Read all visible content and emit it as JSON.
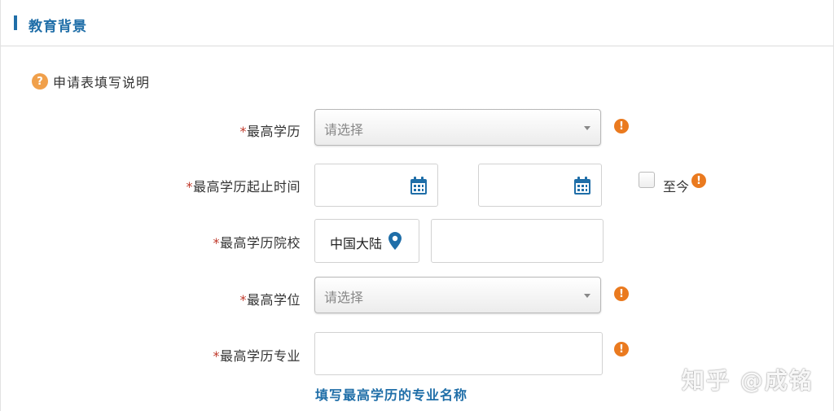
{
  "section": {
    "title": "教育背景"
  },
  "help": {
    "text": "申请表填写说明",
    "icon": "question-icon",
    "icon_glyph": "?"
  },
  "form": {
    "required_mark": "*",
    "highest_education": {
      "label": "最高学历",
      "placeholder": "请选择"
    },
    "education_period": {
      "label": "最高学历起止时间",
      "until_now_label": "至今"
    },
    "school": {
      "label": "最高学历院校",
      "region": "中国大陆"
    },
    "degree": {
      "label": "最高学位",
      "placeholder": "请选择"
    },
    "major": {
      "label": "最高学历专业",
      "hint": "填写最高学历的专业名称"
    },
    "warning_glyph": "!"
  },
  "watermark": "知乎 @成铭",
  "colors": {
    "accent": "#1f6ea8",
    "warning": "#ea7a1f",
    "help": "#f0a04b",
    "required": "#c0392b"
  }
}
